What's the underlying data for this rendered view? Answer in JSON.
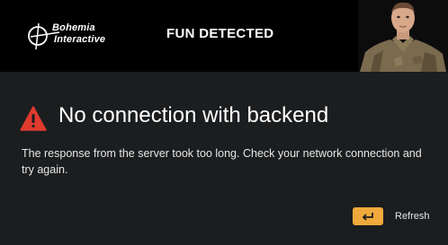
{
  "banner": {
    "logo_line1": "Bohemia",
    "logo_line2": "Interactive",
    "title": "FUN DETECTED",
    "photo_icon": "soldier-portrait-icon"
  },
  "dialog": {
    "icon": "warning-icon",
    "icon_color": "#e03a2e",
    "title": "No connection with backend",
    "message": "The response from the server took too long. Check your network connection and try again.",
    "refresh_label": "Refresh",
    "refresh_key_icon": "enter-key-icon",
    "accent_color": "#f0a93b"
  }
}
